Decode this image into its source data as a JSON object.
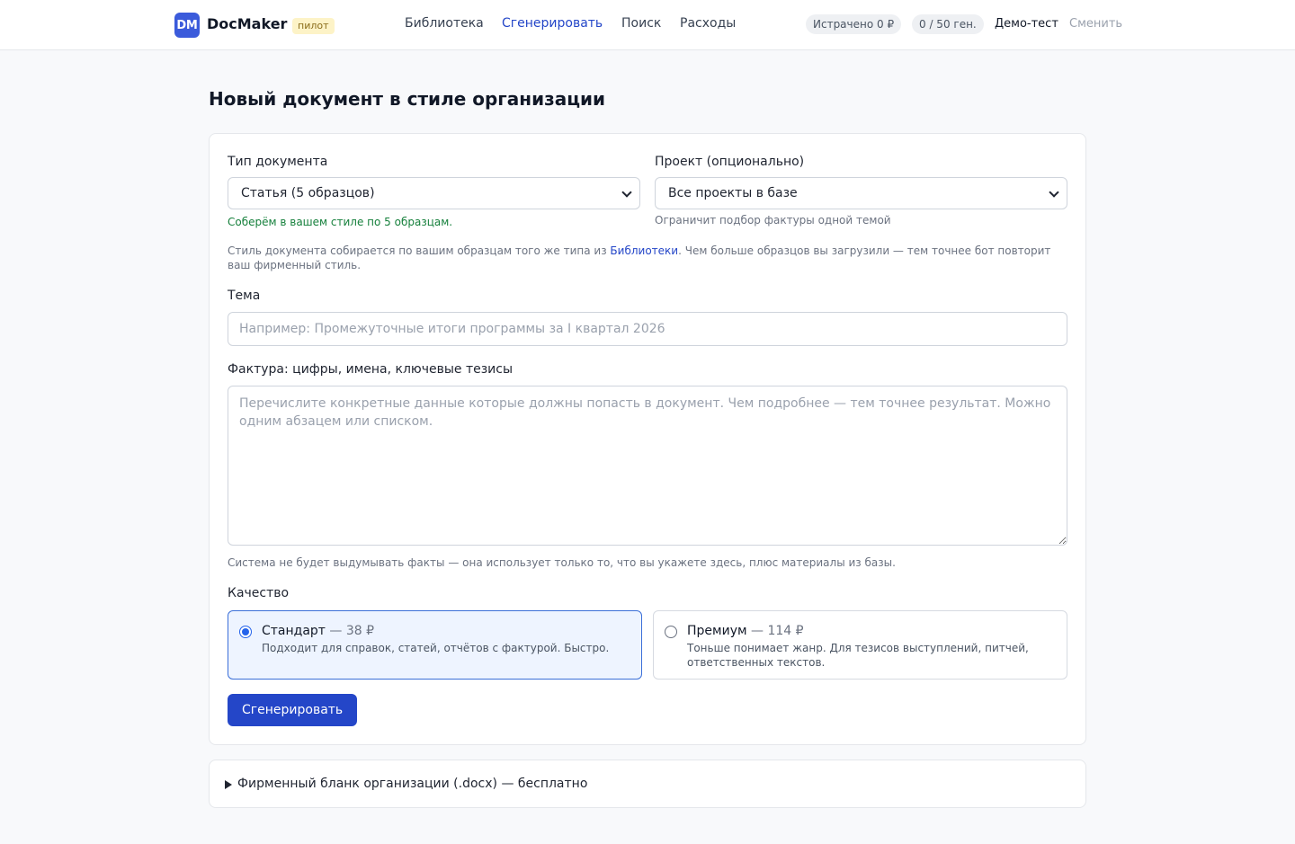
{
  "header": {
    "logo_text": "DM",
    "brand": "DocMaker",
    "badge": "пилот",
    "nav": [
      {
        "label": "Библиотека",
        "active": false
      },
      {
        "label": "Сгенерировать",
        "active": true
      },
      {
        "label": "Поиск",
        "active": false
      },
      {
        "label": "Расходы",
        "active": false
      }
    ],
    "spent": "Истрачено 0 ₽",
    "quota": "0 / 50 ген.",
    "org_name": "Демо-тест",
    "switch_label": "Сменить"
  },
  "page": {
    "title": "Новый документ в стиле организации"
  },
  "form": {
    "doc_type": {
      "label": "Тип документа",
      "value": "Статья (5 образцов)",
      "hint": "Соберём в вашем стиле по 5 образцам."
    },
    "project": {
      "label": "Проект (опционально)",
      "value": "Все проекты в базе",
      "hint": "Ограничит подбор фактуры одной темой"
    },
    "style_note": {
      "before": "Стиль документа собирается по вашим образцам того же типа из ",
      "link": "Библиотеки",
      "after": ". Чем больше образцов вы загрузили — тем точнее бот повторит ваш фирменный стиль."
    },
    "topic": {
      "label": "Тема",
      "placeholder": "Например: Промежуточные итоги программы за I квартал 2026"
    },
    "facts": {
      "label": "Фактура: цифры, имена, ключевые тезисы",
      "placeholder": "Перечислите конкретные данные которые должны попасть в документ. Чем подробнее — тем точнее результат. Можно одним абзацем или списком.",
      "hint": "Система не будет выдумывать факты — она использует только то, что вы укажете здесь, плюс материалы из базы."
    },
    "quality": {
      "label": "Качество",
      "options": [
        {
          "name": "Стандарт",
          "price": " — 38 ₽",
          "desc": "Подходит для справок, статей, отчётов с фактурой. Быстро.",
          "selected": true
        },
        {
          "name": "Премиум",
          "price": " — 114 ₽",
          "desc": "Тоньше понимает жанр. Для тезисов выступлений, питчей, ответственных текстов.",
          "selected": false
        }
      ]
    },
    "submit_label": "Сгенерировать"
  },
  "letterhead": {
    "label": "Фирменный бланк организации (.docx) — бесплатно"
  },
  "colors": {
    "accent": "#2446c8",
    "logo": "#3b5bdb",
    "success_text": "#16803c",
    "badge_bg": "#fdf3c7"
  }
}
